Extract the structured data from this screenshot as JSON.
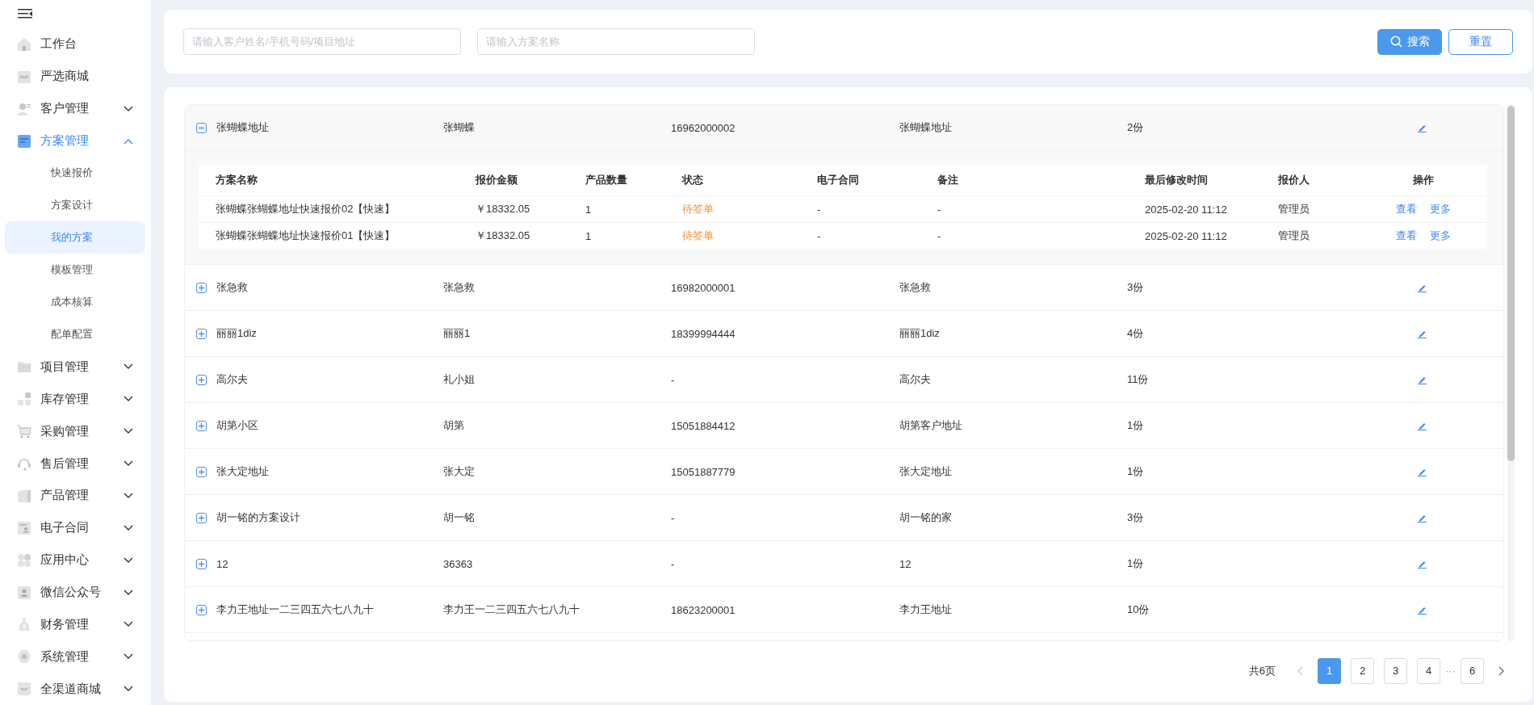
{
  "sidebar": {
    "items": [
      {
        "label": "工作台",
        "kind": "link",
        "selected": false
      },
      {
        "label": "严选商城",
        "kind": "link",
        "selected": false
      },
      {
        "label": "客户管理",
        "kind": "group",
        "selected": false,
        "expanded": false
      },
      {
        "label": "方案管理",
        "kind": "group",
        "selected": true,
        "expanded": true,
        "children": [
          {
            "label": "快速报价",
            "selected": false
          },
          {
            "label": "方案设计",
            "selected": false
          },
          {
            "label": "我的方案",
            "selected": true
          },
          {
            "label": "模板管理",
            "selected": false
          },
          {
            "label": "成本核算",
            "selected": false
          },
          {
            "label": "配单配置",
            "selected": false
          }
        ]
      },
      {
        "label": "项目管理",
        "kind": "group",
        "selected": false,
        "expanded": false
      },
      {
        "label": "库存管理",
        "kind": "group",
        "selected": false,
        "expanded": false
      },
      {
        "label": "采购管理",
        "kind": "group",
        "selected": false,
        "expanded": false
      },
      {
        "label": "售后管理",
        "kind": "group",
        "selected": false,
        "expanded": false
      },
      {
        "label": "产品管理",
        "kind": "group",
        "selected": false,
        "expanded": false
      },
      {
        "label": "电子合同",
        "kind": "group",
        "selected": false,
        "expanded": false
      },
      {
        "label": "应用中心",
        "kind": "group",
        "selected": false,
        "expanded": false
      },
      {
        "label": "微信公众号",
        "kind": "group",
        "selected": false,
        "expanded": false
      },
      {
        "label": "财务管理",
        "kind": "group",
        "selected": false,
        "expanded": false
      },
      {
        "label": "系统管理",
        "kind": "group",
        "selected": false,
        "expanded": false
      },
      {
        "label": "全渠道商城",
        "kind": "group",
        "selected": false,
        "expanded": false
      }
    ]
  },
  "search": {
    "fields": [
      {
        "placeholder": "请输入客户姓名/手机号码/项目地址"
      },
      {
        "placeholder": "请输入方案名称"
      }
    ],
    "search_button": "搜索",
    "reset_button": "重置"
  },
  "table": {
    "rows": [
      {
        "expanded": true,
        "cells": [
          "张蝴蝶地址",
          "张蝴蝶",
          "16962000002",
          "张蝴蝶地址",
          "2份"
        ],
        "plans": {
          "columns": [
            "方案名称",
            "报价金额",
            "产品数量",
            "状态",
            "电子合同",
            "备注",
            "最后修改时间",
            "报价人",
            "操作"
          ],
          "rows": [
            {
              "cells": [
                "张蝴蝶张蝴蝶地址快速报价02【快速】",
                "￥18332.05",
                "1"
              ],
              "status": {
                "text": "待签单",
                "color": "#f7923b"
              },
              "rest": [
                "-",
                "-",
                "2025-02-20 11:12",
                "管理员"
              ],
              "actions": [
                "查看",
                "更多"
              ]
            },
            {
              "cells": [
                "张蝴蝶张蝴蝶地址快速报价01【快速】",
                "￥18332.05",
                "1"
              ],
              "status": {
                "text": "待签单",
                "color": "#f7923b"
              },
              "rest": [
                "-",
                "-",
                "2025-02-20 11:12",
                "管理员"
              ],
              "actions": [
                "查看",
                "更多"
              ]
            }
          ]
        }
      },
      {
        "expanded": false,
        "cells": [
          "张急救",
          "张急救",
          "16982000001",
          "张急救",
          "3份"
        ]
      },
      {
        "expanded": false,
        "cells": [
          "丽丽1diz",
          "丽丽1",
          "18399994444",
          "丽丽1diz",
          "4份"
        ]
      },
      {
        "expanded": false,
        "cells": [
          "高尔夫",
          "礼小姐",
          "-",
          "高尔夫",
          "11份"
        ]
      },
      {
        "expanded": false,
        "cells": [
          "胡第小区",
          "胡第",
          "15051884412",
          "胡第客户地址",
          "1份"
        ]
      },
      {
        "expanded": false,
        "cells": [
          "张大定地址",
          "张大定",
          "15051887779",
          "张大定地址",
          "1份"
        ]
      },
      {
        "expanded": false,
        "cells": [
          "胡一铭的方案设计",
          "胡一铭",
          "-",
          "胡一铭的家",
          "3份"
        ]
      },
      {
        "expanded": false,
        "cells": [
          "12",
          "36363",
          "-",
          "12",
          "1份"
        ]
      },
      {
        "expanded": false,
        "cells": [
          "李力王地址一二三四五六七八九十",
          "李力王一二三四五六七八九十",
          "18623200001",
          "李力王地址",
          "10份"
        ]
      }
    ]
  },
  "pagination": {
    "total": "共6页",
    "prev_disabled": true,
    "next_disabled": false,
    "pages": [
      {
        "kind": "page",
        "label": "1",
        "selected": true
      },
      {
        "kind": "page",
        "label": "2",
        "selected": false
      },
      {
        "kind": "page",
        "label": "3",
        "selected": false
      },
      {
        "kind": "page",
        "label": "4",
        "selected": false
      },
      {
        "kind": "ellipsis",
        "label": "···"
      },
      {
        "kind": "page",
        "label": "6",
        "selected": false
      }
    ]
  }
}
